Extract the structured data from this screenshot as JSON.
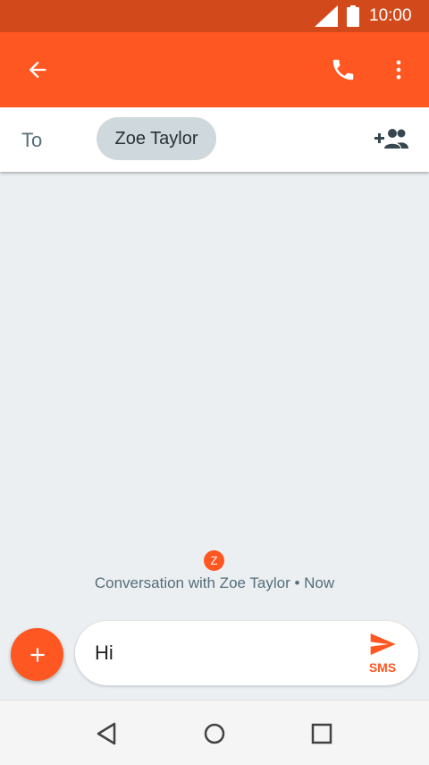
{
  "status_bar": {
    "time": "10:00",
    "icons": [
      "signal-icon",
      "battery-icon"
    ]
  },
  "app_bar": {
    "icons": [
      "back-arrow-icon",
      "phone-icon",
      "more-vert-icon"
    ]
  },
  "recipients": {
    "to_label": "To",
    "chip_name": "Zoe Taylor",
    "add_icon": "add-contact-icon"
  },
  "conversation": {
    "avatar_letter": "Z",
    "info": "Conversation with Zoe Taylor • Now"
  },
  "composer": {
    "attach_icon": "plus-icon",
    "message": "Hi",
    "send_icon": "send-icon",
    "send_label": "SMS"
  },
  "nav_bar": {
    "icons": [
      "nav-back-icon",
      "nav-home-icon",
      "nav-recents-icon"
    ]
  },
  "colors": {
    "accent": "#ff5722",
    "status_bar": "#d24a1c",
    "background": "#eceff1",
    "chip": "#cfd8dc"
  }
}
